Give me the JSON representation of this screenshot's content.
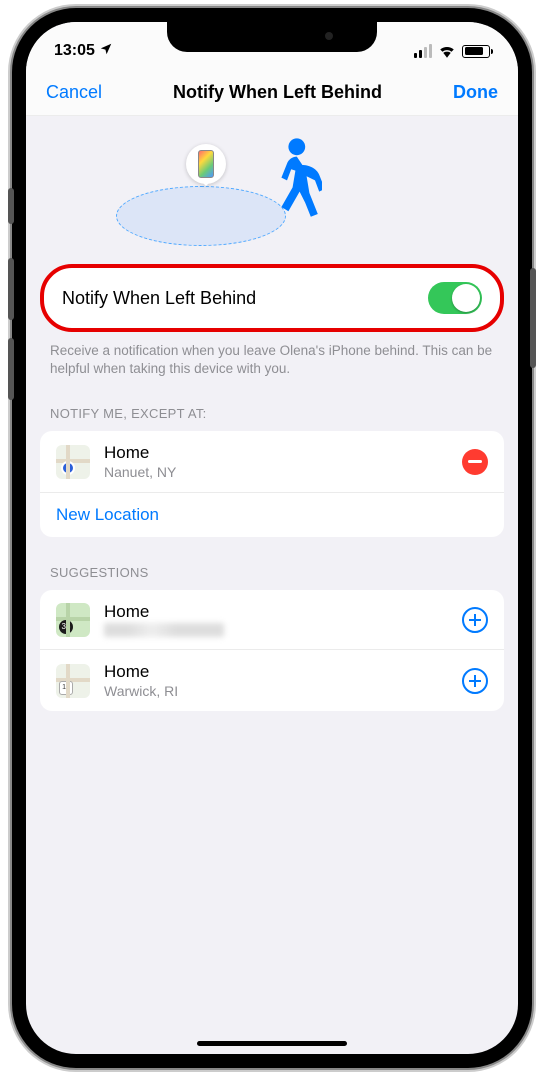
{
  "status": {
    "time": "13:05",
    "battery_pct": 70
  },
  "nav": {
    "cancel": "Cancel",
    "title": "Notify When Left Behind",
    "done": "Done"
  },
  "toggle": {
    "label": "Notify When Left Behind",
    "on": true
  },
  "description": "Receive a notification when you leave Olena's iPhone behind. This can be helpful when taking this device with you.",
  "except_header": "NOTIFY ME, EXCEPT AT:",
  "except_items": [
    {
      "title": "Home",
      "subtitle": "Nanuet, NY"
    }
  ],
  "new_location": "New Location",
  "suggestions_header": "SUGGESTIONS",
  "suggestions": [
    {
      "title": "Home",
      "subtitle": "",
      "badge": "36"
    },
    {
      "title": "Home",
      "subtitle": "Warwick, RI",
      "badge": "17"
    }
  ]
}
